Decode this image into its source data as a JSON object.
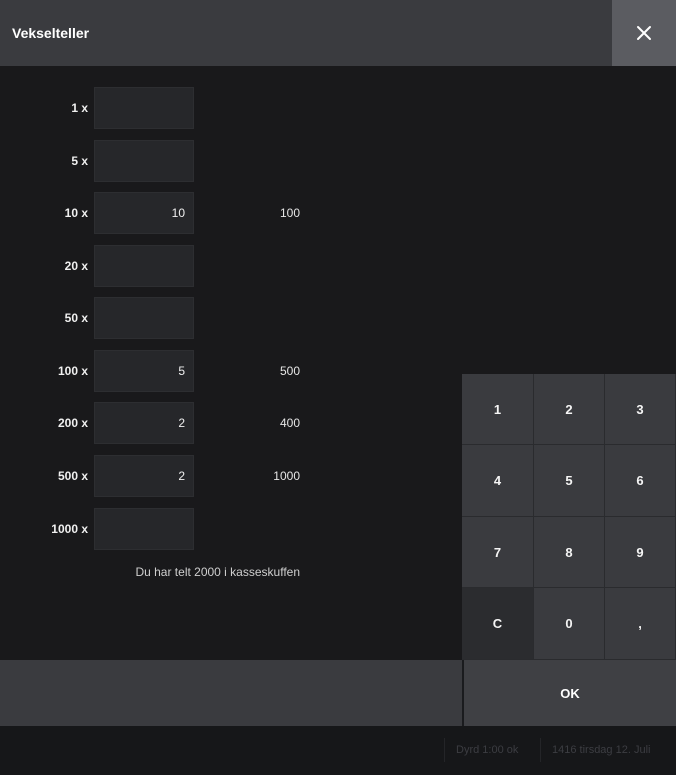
{
  "header": {
    "title": "Vekselteller"
  },
  "denominations": [
    {
      "label": "1 x",
      "value": "",
      "total": ""
    },
    {
      "label": "5 x",
      "value": "",
      "total": ""
    },
    {
      "label": "10 x",
      "value": "10",
      "total": "100"
    },
    {
      "label": "20 x",
      "value": "",
      "total": ""
    },
    {
      "label": "50 x",
      "value": "",
      "total": ""
    },
    {
      "label": "100 x",
      "value": "5",
      "total": "500"
    },
    {
      "label": "200 x",
      "value": "2",
      "total": "400"
    },
    {
      "label": "500 x",
      "value": "2",
      "total": "1000"
    },
    {
      "label": "1000 x",
      "value": "",
      "total": ""
    }
  ],
  "summary": "Du har telt 2000 i kasseskuffen",
  "keypad": {
    "keys": [
      "1",
      "2",
      "3",
      "4",
      "5",
      "6",
      "7",
      "8",
      "9",
      "C",
      "0",
      ","
    ]
  },
  "footer": {
    "ok_label": "OK"
  },
  "statusbar": {
    "left": "Dyrd 1:00 ok",
    "right": "1416 tirsdag 12. Juli"
  },
  "icons": {
    "close": "close-icon"
  },
  "colors": {
    "header_bg": "#3a3b3f",
    "close_bg": "#5b5c61",
    "key_bg": "#3a3b3f",
    "key_clear_bg": "#2b2c2f",
    "content_bg": "#19191b"
  }
}
